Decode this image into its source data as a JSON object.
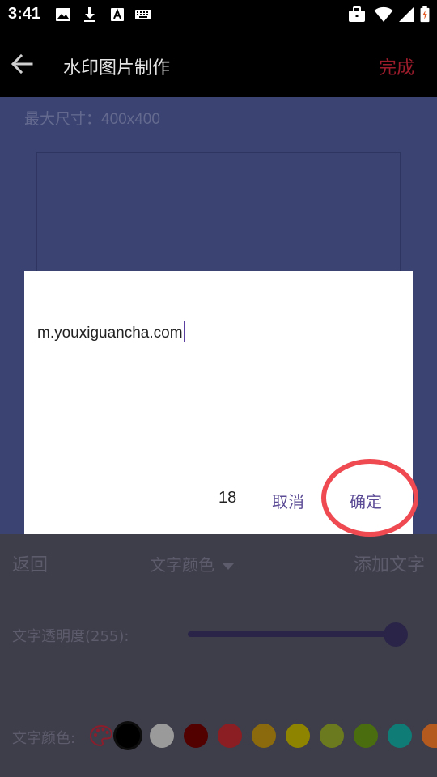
{
  "status_bar": {
    "time": "3:41",
    "left_icons": [
      "image-icon",
      "download-icon",
      "a-box-icon",
      "keyboard-icon"
    ],
    "right_icons": [
      "briefcase-icon",
      "wifi-icon",
      "signal-icon",
      "battery-icon"
    ]
  },
  "app_bar": {
    "back_icon": "arrow-left-icon",
    "title": "水印图片制作",
    "done_label": "完成",
    "done_color": "#9c1c2c"
  },
  "content": {
    "max_size_text": "最大尺寸：400x400",
    "background_color": "#3a4371"
  },
  "dialog": {
    "input_value": "m.youxiguancha.com",
    "count": "18",
    "cancel_label": "取消",
    "confirm_label": "确定",
    "accent_color": "#5b4a95"
  },
  "panel": {
    "back_label": "返回",
    "color_selector_label": "文字颜色",
    "add_text_label": "添加文字",
    "opacity_label": "文字透明度(255):",
    "opacity_value": 255,
    "opacity_max": 255,
    "color_label": "文字颜色:",
    "palette_icon": "palette-icon",
    "swatches": [
      {
        "color": "#000000",
        "selected": true
      },
      {
        "color": "#9a9a9a",
        "selected": false
      },
      {
        "color": "#520000",
        "selected": false
      },
      {
        "color": "#8b1e22",
        "selected": false
      },
      {
        "color": "#8a6a0c",
        "selected": false
      },
      {
        "color": "#8e8400",
        "selected": false
      },
      {
        "color": "#6b7a1e",
        "selected": false
      },
      {
        "color": "#4a6d10",
        "selected": false
      },
      {
        "color": "#0f7c76",
        "selected": false
      },
      {
        "color": "#b45a1e",
        "selected": false
      }
    ]
  },
  "annotation": {
    "highlight_color": "#ef4a52"
  }
}
